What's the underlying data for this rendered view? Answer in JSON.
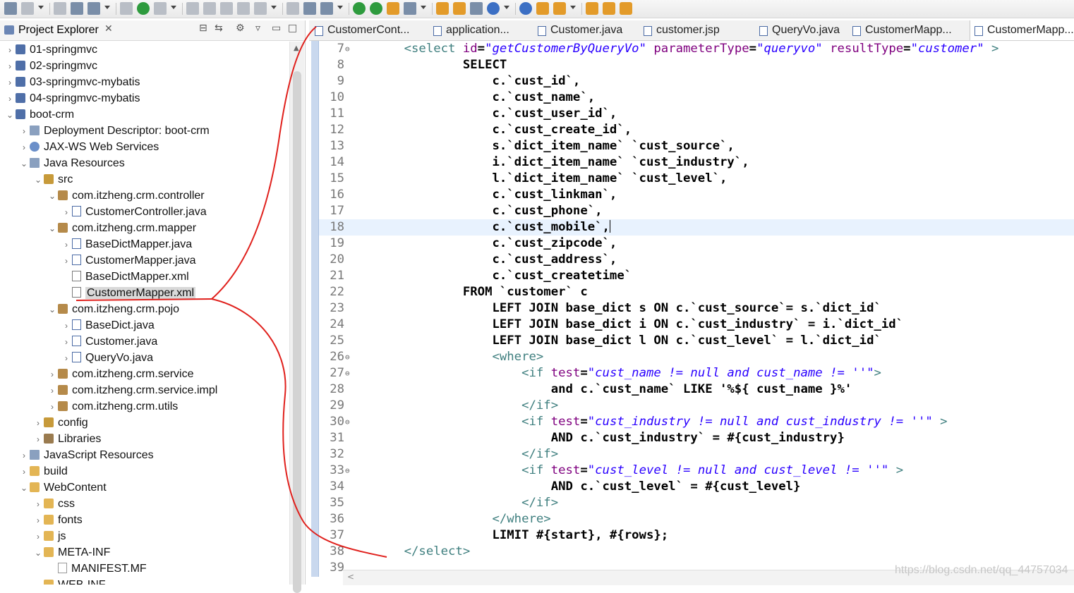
{
  "toolbar": {
    "icons": [
      "new-icon",
      "save-icon",
      "save-all-icon",
      "print-icon",
      "search-icon",
      "skip-breakpoints-icon",
      "resume-icon",
      "suspend-icon",
      "terminate-icon",
      "disconnect-icon",
      "step-into-icon",
      "step-over-icon",
      "step-return-icon",
      "drop-to-frame-icon",
      "use-step-filters-icon",
      "debug-icon",
      "run-icon",
      "coverage-icon",
      "external-tools-icon",
      "new-server-icon",
      "new-java-project-icon",
      "open-type-icon",
      "open-task-icon",
      "search-web-icon",
      "toggle-annotation-icon",
      "next-annotation-icon",
      "previous-annotation-icon",
      "last-edit-icon",
      "back-icon",
      "forward-icon"
    ]
  },
  "explorer": {
    "title": "Project Explorer",
    "close_glyph": "✕",
    "items": [
      {
        "label": "01-springmvc",
        "depth": 0,
        "expanded": false,
        "icon": "project-icon"
      },
      {
        "label": "02-springmvc",
        "depth": 0,
        "expanded": false,
        "icon": "project-icon"
      },
      {
        "label": "03-springmvc-mybatis",
        "depth": 0,
        "expanded": false,
        "icon": "project-icon"
      },
      {
        "label": "04-springmvc-mybatis",
        "depth": 0,
        "expanded": false,
        "icon": "project-icon"
      },
      {
        "label": "boot-crm",
        "depth": 0,
        "expanded": true,
        "icon": "project-icon"
      },
      {
        "label": "Deployment Descriptor: boot-crm",
        "depth": 1,
        "expanded": false,
        "icon": "descriptor-icon"
      },
      {
        "label": "JAX-WS Web Services",
        "depth": 1,
        "expanded": false,
        "icon": "webservice-icon"
      },
      {
        "label": "Java Resources",
        "depth": 1,
        "expanded": true,
        "icon": "java-resources-icon"
      },
      {
        "label": "src",
        "depth": 2,
        "expanded": true,
        "icon": "source-folder-icon"
      },
      {
        "label": "com.itzheng.crm.controller",
        "depth": 3,
        "expanded": true,
        "icon": "package-icon"
      },
      {
        "label": "CustomerController.java",
        "depth": 4,
        "expanded": false,
        "icon": "java-file-icon"
      },
      {
        "label": "com.itzheng.crm.mapper",
        "depth": 3,
        "expanded": true,
        "icon": "package-icon"
      },
      {
        "label": "BaseDictMapper.java",
        "depth": 4,
        "expanded": false,
        "icon": "java-interface-icon"
      },
      {
        "label": "CustomerMapper.java",
        "depth": 4,
        "expanded": false,
        "icon": "java-interface-icon"
      },
      {
        "label": "BaseDictMapper.xml",
        "depth": 4,
        "leaf": true,
        "icon": "xml-file-icon"
      },
      {
        "label": "CustomerMapper.xml",
        "depth": 4,
        "leaf": true,
        "icon": "xml-file-icon",
        "selected": true
      },
      {
        "label": "com.itzheng.crm.pojo",
        "depth": 3,
        "expanded": true,
        "icon": "package-icon"
      },
      {
        "label": "BaseDict.java",
        "depth": 4,
        "expanded": false,
        "icon": "java-file-icon"
      },
      {
        "label": "Customer.java",
        "depth": 4,
        "expanded": false,
        "icon": "java-file-icon"
      },
      {
        "label": "QueryVo.java",
        "depth": 4,
        "expanded": false,
        "icon": "java-file-icon"
      },
      {
        "label": "com.itzheng.crm.service",
        "depth": 3,
        "expanded": false,
        "icon": "package-icon"
      },
      {
        "label": "com.itzheng.crm.service.impl",
        "depth": 3,
        "expanded": false,
        "icon": "package-icon"
      },
      {
        "label": "com.itzheng.crm.utils",
        "depth": 3,
        "expanded": false,
        "icon": "package-icon"
      },
      {
        "label": "config",
        "depth": 2,
        "expanded": false,
        "icon": "source-folder-icon"
      },
      {
        "label": "Libraries",
        "depth": 2,
        "expanded": false,
        "icon": "library-icon"
      },
      {
        "label": "JavaScript Resources",
        "depth": 1,
        "expanded": false,
        "icon": "js-resources-icon"
      },
      {
        "label": "build",
        "depth": 1,
        "expanded": false,
        "icon": "folder-icon"
      },
      {
        "label": "WebContent",
        "depth": 1,
        "expanded": true,
        "icon": "folder-icon"
      },
      {
        "label": "css",
        "depth": 2,
        "expanded": false,
        "icon": "folder-icon"
      },
      {
        "label": "fonts",
        "depth": 2,
        "expanded": false,
        "icon": "folder-icon"
      },
      {
        "label": "js",
        "depth": 2,
        "expanded": false,
        "icon": "folder-icon"
      },
      {
        "label": "META-INF",
        "depth": 2,
        "expanded": true,
        "icon": "folder-icon"
      },
      {
        "label": "MANIFEST.MF",
        "depth": 3,
        "leaf": true,
        "icon": "file-icon"
      },
      {
        "label": "WEB-INF",
        "depth": 2,
        "expanded": true,
        "icon": "folder-icon"
      }
    ]
  },
  "editor": {
    "tabs": [
      {
        "label": "CustomerCont...",
        "active": false
      },
      {
        "label": "application...",
        "active": false
      },
      {
        "label": "Customer.java",
        "active": false
      },
      {
        "label": "customer.jsp",
        "active": false
      },
      {
        "label": "QueryVo.java",
        "active": false
      },
      {
        "label": "CustomerMapp...",
        "active": false
      },
      {
        "label": "CustomerMapp...",
        "active": true
      }
    ],
    "current_line": "18",
    "lines": [
      {
        "n": "7",
        "fold": true,
        "segs": [
          [
            "",
            "    "
          ],
          [
            "tag",
            "<select "
          ],
          [
            "attr",
            "id"
          ],
          [
            "",
            "="
          ],
          [
            "val",
            "\"getCustomerByQueryVo\""
          ],
          [
            "",
            " "
          ],
          [
            "attr",
            "parameterType"
          ],
          [
            "",
            "="
          ],
          [
            "val",
            "\"queryvo\""
          ],
          [
            "",
            " "
          ],
          [
            "attr",
            "resultType"
          ],
          [
            "",
            "="
          ],
          [
            "val",
            "\"customer\""
          ],
          [
            "tag",
            " >"
          ]
        ]
      },
      {
        "n": "8",
        "segs": [
          [
            "",
            "            SELECT"
          ]
        ]
      },
      {
        "n": "9",
        "segs": [
          [
            "",
            "                c.`cust_id`,"
          ]
        ]
      },
      {
        "n": "10",
        "segs": [
          [
            "",
            "                c.`cust_name`,"
          ]
        ]
      },
      {
        "n": "11",
        "segs": [
          [
            "",
            "                c.`cust_user_id`,"
          ]
        ]
      },
      {
        "n": "12",
        "segs": [
          [
            "",
            "                c.`cust_create_id`,"
          ]
        ]
      },
      {
        "n": "13",
        "segs": [
          [
            "",
            "                s.`dict_item_name` `cust_source`,"
          ]
        ]
      },
      {
        "n": "14",
        "segs": [
          [
            "",
            "                i.`dict_item_name` `cust_industry`,"
          ]
        ]
      },
      {
        "n": "15",
        "segs": [
          [
            "",
            "                l.`dict_item_name` `cust_level`,"
          ]
        ]
      },
      {
        "n": "16",
        "segs": [
          [
            "",
            "                c.`cust_linkman`,"
          ]
        ]
      },
      {
        "n": "17",
        "segs": [
          [
            "",
            "                c.`cust_phone`,"
          ]
        ]
      },
      {
        "n": "18",
        "segs": [
          [
            "",
            "                c.`cust_mobile`,"
          ]
        ],
        "caret": true
      },
      {
        "n": "19",
        "segs": [
          [
            "",
            "                c.`cust_zipcode`,"
          ]
        ]
      },
      {
        "n": "20",
        "segs": [
          [
            "",
            "                c.`cust_address`,"
          ]
        ]
      },
      {
        "n": "21",
        "segs": [
          [
            "",
            "                c.`cust_createtime`"
          ]
        ]
      },
      {
        "n": "22",
        "segs": [
          [
            "",
            "            FROM `customer` c"
          ]
        ]
      },
      {
        "n": "23",
        "segs": [
          [
            "",
            "                LEFT JOIN base_dict s ON c.`cust_source`= s.`dict_id`"
          ]
        ]
      },
      {
        "n": "24",
        "segs": [
          [
            "",
            "                LEFT JOIN base_dict i ON c.`cust_industry` = i.`dict_id`"
          ]
        ]
      },
      {
        "n": "25",
        "segs": [
          [
            "",
            "                LEFT JOIN base_dict l ON c.`cust_level` = l.`dict_id`"
          ]
        ]
      },
      {
        "n": "26",
        "fold": true,
        "segs": [
          [
            "",
            "                "
          ],
          [
            "tag",
            "<where>"
          ]
        ]
      },
      {
        "n": "27",
        "fold": true,
        "segs": [
          [
            "",
            "                    "
          ],
          [
            "tag",
            "<if "
          ],
          [
            "attr",
            "test"
          ],
          [
            "",
            "="
          ],
          [
            "val",
            "\"cust_name != null and cust_name != ''\""
          ],
          [
            "tag",
            ">"
          ]
        ]
      },
      {
        "n": "28",
        "segs": [
          [
            "",
            "                        and c.`cust_name` LIKE '%${ cust_name }%'"
          ]
        ]
      },
      {
        "n": "29",
        "segs": [
          [
            "",
            "                    "
          ],
          [
            "tag",
            "</if>"
          ]
        ]
      },
      {
        "n": "30",
        "fold": true,
        "segs": [
          [
            "",
            "                    "
          ],
          [
            "tag",
            "<if "
          ],
          [
            "attr",
            "test"
          ],
          [
            "",
            "="
          ],
          [
            "val",
            "\"cust_industry != null and cust_industry != ''\""
          ],
          [
            "tag",
            " >"
          ]
        ]
      },
      {
        "n": "31",
        "segs": [
          [
            "",
            "                        AND c.`cust_industry` = #{cust_industry}"
          ]
        ]
      },
      {
        "n": "32",
        "segs": [
          [
            "",
            "                    "
          ],
          [
            "tag",
            "</if>"
          ]
        ]
      },
      {
        "n": "33",
        "fold": true,
        "segs": [
          [
            "",
            "                    "
          ],
          [
            "tag",
            "<if "
          ],
          [
            "attr",
            "test"
          ],
          [
            "",
            "="
          ],
          [
            "val",
            "\"cust_level != null and cust_level != ''\""
          ],
          [
            "tag",
            " >"
          ]
        ]
      },
      {
        "n": "34",
        "segs": [
          [
            "",
            "                        AND c.`cust_level` = #{cust_level}"
          ]
        ]
      },
      {
        "n": "35",
        "segs": [
          [
            "",
            "                    "
          ],
          [
            "tag",
            "</if>"
          ]
        ]
      },
      {
        "n": "36",
        "segs": [
          [
            "",
            "                "
          ],
          [
            "tag",
            "</where>"
          ]
        ]
      },
      {
        "n": "37",
        "segs": [
          [
            "",
            "                LIMIT #{start}, #{rows};"
          ]
        ]
      },
      {
        "n": "38",
        "segs": [
          [
            "",
            "    "
          ],
          [
            "tag",
            "</select>"
          ]
        ]
      },
      {
        "n": "39",
        "segs": [
          [
            "",
            ""
          ]
        ]
      }
    ]
  },
  "annotation": {
    "color": "#e0201c",
    "kind": "hand-drawn-arrow"
  },
  "watermark": "https://blog.csdn.net/qq_44757034",
  "colors": {
    "tag": "#3f7f7f",
    "attribute": "#7f007f",
    "value": "#2a00ff",
    "selection": "#e8f2fe"
  }
}
